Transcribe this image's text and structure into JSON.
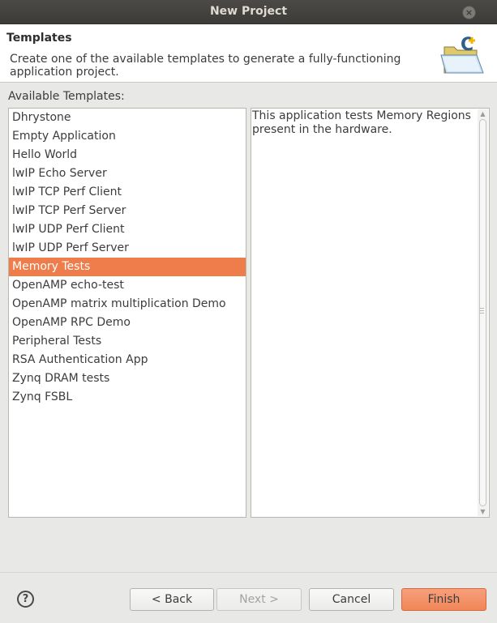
{
  "window": {
    "title": "New Project",
    "close_glyph": "×"
  },
  "header": {
    "title": "Templates",
    "description": "Create one of the available templates to generate a fully-functioning application project.",
    "icon": "new-c-project-folder-icon"
  },
  "templates": {
    "label": "Available Templates:",
    "items": [
      "Dhrystone",
      "Empty Application",
      "Hello World",
      "lwIP Echo Server",
      "lwIP TCP Perf Client",
      "lwIP TCP Perf Server",
      "lwIP UDP Perf Client",
      "lwIP UDP Perf Server",
      "Memory Tests",
      "OpenAMP echo-test",
      "OpenAMP matrix multiplication Demo",
      "OpenAMP RPC Demo",
      "Peripheral Tests",
      "RSA Authentication App",
      "Zynq DRAM tests",
      "Zynq FSBL"
    ],
    "selected_index": 8
  },
  "description_panel": {
    "text": "This application tests Memory Regions present in the hardware."
  },
  "buttons": {
    "help": "?",
    "back": "< Back",
    "next": "Next >",
    "cancel": "Cancel",
    "finish": "Finish"
  },
  "colors": {
    "selection": "#ef7d4b",
    "finish_button": "#f18658",
    "titlebar": "#3c3b37"
  }
}
